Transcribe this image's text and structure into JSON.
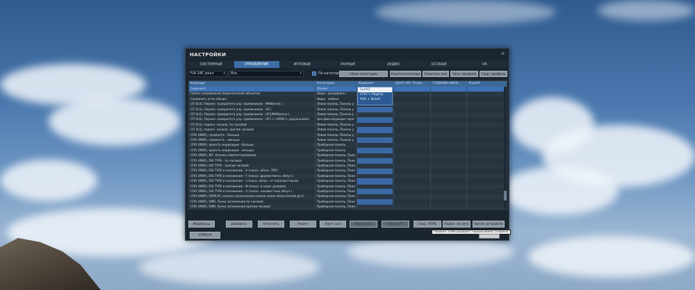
{
  "window": {
    "title": "НАСТРОЙКИ",
    "close_icon": "close-icon"
  },
  "tabs": [
    "СИСТЕМНЫЕ",
    "УПРАВЛЕНИЕ",
    "ИГРОВЫЕ",
    "РАЗНЫЕ",
    "АУДИО",
    "ОСОБЫЕ",
    "VR"
  ],
  "active_tab": "УПРАВЛЕНИЕ",
  "toolbar": {
    "aircraft_select": "F/A-18C реал",
    "category_select": "Все",
    "by_categories_label": "По категориям",
    "buttons": [
      "Сброс категории",
      "Очистка категории",
      "Очистить все",
      "Загр. профиль",
      "Сохр. профиль"
    ]
  },
  "table": {
    "headers": [
      "Команда",
      "Категория",
      "Keyboard",
      "ЦЕНТ УРС Thrott...",
      "T.16000M (9B2D...",
      "TrackIR"
    ],
    "rows": [
      [
        "Скриншот",
        "Общие",
        "SysRQ"
      ],
      [
        "Смена направления переключения объектов",
        "Виды - расширенн.",
        "LCtrl + Pagecp"
      ],
      [
        "Сохранить углы обзора",
        "Виды - кабина",
        "RAlt + Num0"
      ],
      [
        "СП (ILS), Перекл. приоритета упр. приемником - MAN(огон.)",
        "Левая панель, Панель у",
        ""
      ],
      [
        "СП (ILS), Перекл. приоритета упр. приемником - UFC",
        "Левая панель, Панель у",
        ""
      ],
      [
        "СП (ILS), Перекл. приоритета упр. приемником - UFC/MAN(огон.)",
        "Левая панель, Панель у",
        ""
      ],
      [
        "СП (ILS), Перекл. приоритета упр. приемником - UFC<->MAN (с удержанием)",
        "Цен.фиксирующие пере",
        ""
      ],
      [
        "СП (ILS), перекл. канала. по часовой",
        "Левая панель, Панель у",
        ""
      ],
      [
        "СП (ILS), перекл. канала. против часовой",
        "Левая панель, Панель у",
        ""
      ],
      [
        "СПО (RWR), громкость - больше",
        "Левая панель, Панель у",
        ""
      ],
      [
        "СПО (RWR), громкость - меньше",
        "Левая панель, Панель у",
        ""
      ],
      [
        "СПО (RWR), яркость индикации - больше",
        "Приборная панель",
        ""
      ],
      [
        "СПО (RWR), яркость индикации - меньше",
        "Приборная панель",
        ""
      ],
      [
        "СПО (RWR), BIT, Кнопка самотестирования",
        "Приборная панель, Пане",
        ""
      ],
      [
        "СПО (RWR), DIS TYPE - по часовой",
        "Приборная панель, Пане",
        ""
      ],
      [
        "СПО (RWR), DIS TYPE - против часовой",
        "Приборная панель, Пане",
        ""
      ],
      [
        "СПО (RWR), DIS TYPE в положение - A (показ. облуч. ЗРК)",
        "Приборная панель, Пане",
        ""
      ],
      [
        "СПО (RWR), DIS TYPE в положение - F (показ. дружественн. облуч.)",
        "Приборная панель, Пане",
        ""
      ],
      [
        "СПО (RWR), DIS TYPE в положение - I (показ. облуч. от перехватчиков)",
        "Приборная панель, Пане",
        ""
      ],
      [
        "СПО (RWR), DIS TYPE в положение - N (показ. в норм. режиме)",
        "Приборная панель, Пане",
        ""
      ],
      [
        "СПО (RWR), DIS TYPE в положение - U (показ. неизвестных облуч.)",
        "Приборная панель, Пане",
        ""
      ],
      [
        "СПО (RWR), DISPLAY, кнопка ограничения показа колов облучателей до 6",
        "Приборная панель, Пане",
        ""
      ],
      [
        "СПО (RWR), DMR, Ручка затемнения по часовой",
        "Приборная панель, Пане",
        ""
      ],
      [
        "СПО (RWR), DMR, Ручка затемнения против часовой",
        "Приборная панель, Пане",
        ""
      ]
    ],
    "keyboard_dropdown": [
      "SysRQ",
      "LCtrl + Pagecp",
      "RAlt + Num0"
    ]
  },
  "bottom_buttons": [
    "Модиф-ры",
    "Добавить",
    "Очистить",
    "Умолч.",
    "Наст. оси",
    "Настр. оси",
    "Настр. FF",
    "Сохр. HTML",
    "Подкл. на лету",
    "Орган. устройств"
  ],
  "tooltip": "Нажмите, чтобы расширить \"горячую замену\" устройств",
  "cancel_label": "ОТМЕНА",
  "colors": {
    "accent": "#3e6ea6",
    "panel_bg": "#1b2530"
  }
}
